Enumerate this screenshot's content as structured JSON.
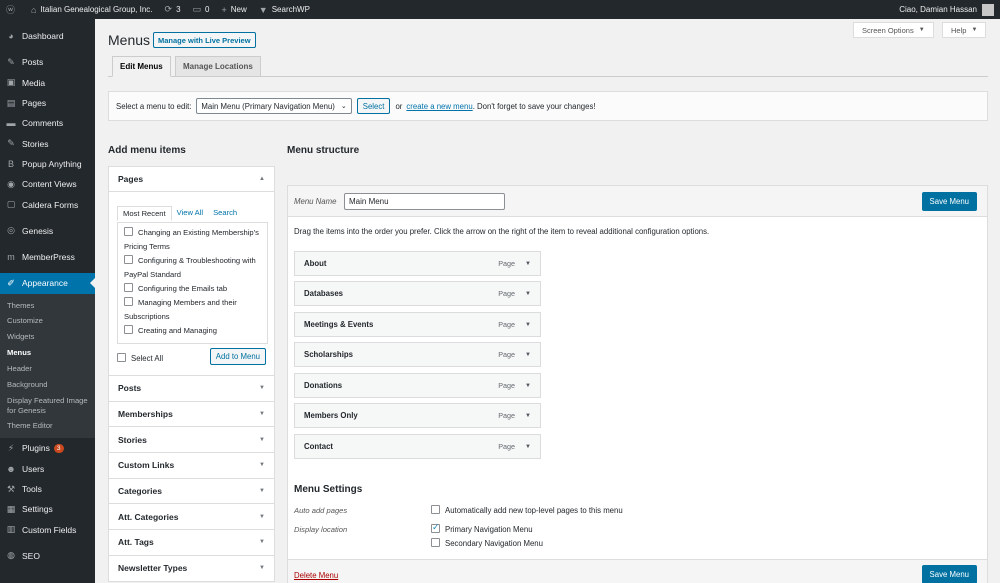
{
  "adminbar": {
    "site_name": "Italian Genealogical Group, Inc.",
    "updates_count": "3",
    "comments_count": "0",
    "new_label": "New",
    "searchwp_label": "SearchWP",
    "greeting": "Ciao, Damian Hassan"
  },
  "sidebar": {
    "items_top": [
      {
        "label": "Dashboard",
        "icon": "dashboard-icon"
      },
      {
        "label": "Posts",
        "icon": "pin-icon"
      },
      {
        "label": "Media",
        "icon": "media-icon"
      },
      {
        "label": "Pages",
        "icon": "pages-icon"
      },
      {
        "label": "Comments",
        "icon": "comment-icon"
      },
      {
        "label": "Stories",
        "icon": "pin-icon"
      },
      {
        "label": "Popup Anything",
        "icon": "b-icon"
      },
      {
        "label": "Content Views",
        "icon": "wp-icon"
      },
      {
        "label": "Caldera Forms",
        "icon": "caldera-icon"
      },
      {
        "label": "Genesis",
        "icon": "genesis-icon"
      },
      {
        "label": "MemberPress",
        "icon": "memberpress-icon"
      },
      {
        "label": "Appearance",
        "icon": "brush-icon"
      }
    ],
    "appearance_submenu": [
      "Themes",
      "Customize",
      "Widgets",
      "Menus",
      "Header",
      "Background",
      "Display Featured Image for Genesis",
      "Theme Editor"
    ],
    "items_bottom": [
      {
        "label": "Plugins",
        "icon": "plugin-icon",
        "badge": "3"
      },
      {
        "label": "Users",
        "icon": "users-icon"
      },
      {
        "label": "Tools",
        "icon": "tools-icon"
      },
      {
        "label": "Settings",
        "icon": "settings-icon"
      },
      {
        "label": "Custom Fields",
        "icon": "fields-icon"
      },
      {
        "label": "SEO",
        "icon": "seo-icon"
      }
    ]
  },
  "header": {
    "screen_options": "Screen Options",
    "help": "Help",
    "title": "Menus",
    "live_preview": "Manage with Live Preview",
    "tabs": [
      "Edit Menus",
      "Manage Locations"
    ]
  },
  "manage": {
    "prompt": "Select a menu to edit:",
    "selected_menu": "Main Menu (Primary Navigation Menu)",
    "select_btn": "Select",
    "or": "or",
    "create_link": "create a new menu",
    "reminder": ". Don't forget to save your changes!"
  },
  "left": {
    "title": "Add menu items",
    "pages_heading": "Pages",
    "page_tabs": [
      "Most Recent",
      "View All",
      "Search"
    ],
    "pages": [
      "Changing an Existing Membership's Pricing Terms",
      "Configuring & Troubleshooting with PayPal Standard",
      "Configuring the Emails tab",
      "Managing Members and their Subscriptions",
      "Creating and Managing"
    ],
    "select_all": "Select All",
    "add_to_menu": "Add to Menu",
    "sections": [
      "Posts",
      "Memberships",
      "Stories",
      "Custom Links",
      "Categories",
      "Att. Categories",
      "Att. Tags",
      "Newsletter Types"
    ]
  },
  "right": {
    "title": "Menu structure",
    "menu_name_label": "Menu Name",
    "menu_name_value": "Main Menu",
    "save_menu": "Save Menu",
    "instructions": "Drag the items into the order you prefer. Click the arrow on the right of the item to reveal additional configuration options.",
    "items": [
      {
        "title": "About",
        "type": "Page"
      },
      {
        "title": "Databases",
        "type": "Page"
      },
      {
        "title": "Meetings & Events",
        "type": "Page"
      },
      {
        "title": "Scholarships",
        "type": "Page"
      },
      {
        "title": "Donations",
        "type": "Page"
      },
      {
        "title": "Members Only",
        "type": "Page"
      },
      {
        "title": "Contact",
        "type": "Page"
      }
    ],
    "settings_title": "Menu Settings",
    "auto_add_label": "Auto add pages",
    "auto_add_option": "Automatically add new top-level pages to this menu",
    "display_location_label": "Display location",
    "primary_location": "Primary Navigation Menu",
    "secondary_location": "Secondary Navigation Menu",
    "delete_menu": "Delete Menu"
  }
}
